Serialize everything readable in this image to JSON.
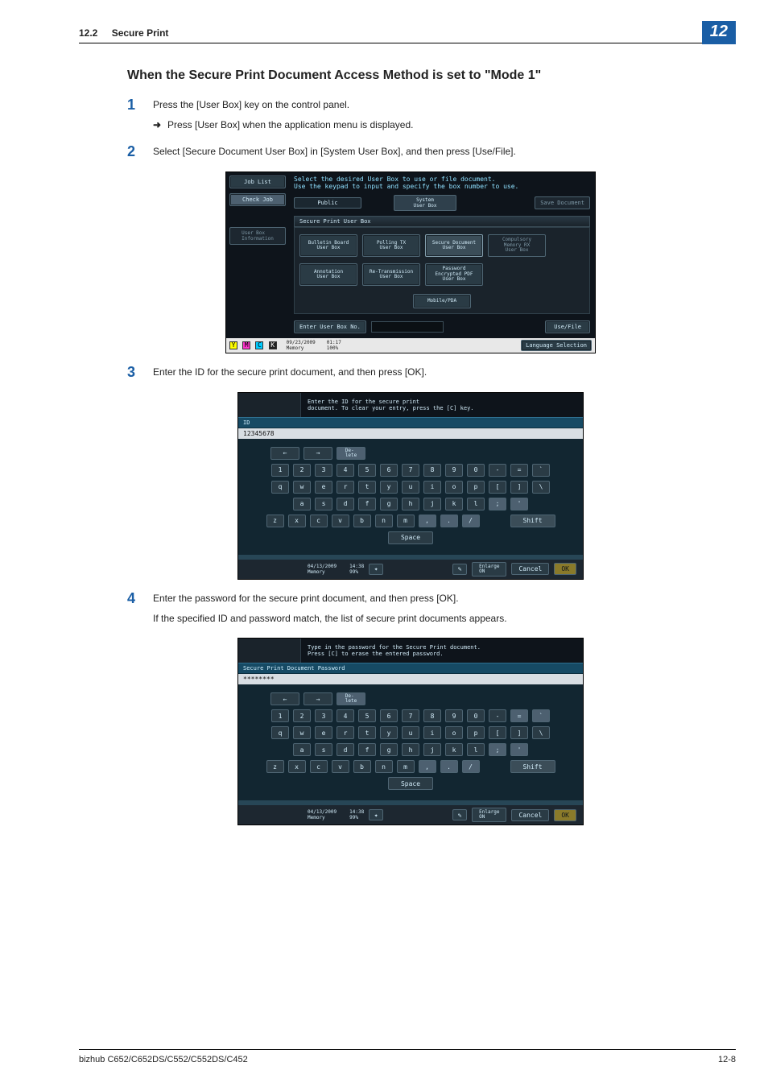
{
  "header": {
    "section_no": "12.2",
    "section_title": "Secure Print",
    "chapter_badge": "12"
  },
  "footer": {
    "model_line": "bizhub C652/C652DS/C552/C552DS/C452",
    "page_no": "12-8"
  },
  "body": {
    "subheading": "When the Secure Print Document Access Method is set to \"Mode 1\"",
    "step1": {
      "num": "1",
      "text": "Press the [User Box] key on the control panel.",
      "sub_arrow": "➜",
      "sub_text": "Press [User Box] when the application menu is displayed."
    },
    "step2": {
      "num": "2",
      "text": "Select [Secure Document User Box] in [System User Box], and then press [Use/File]."
    },
    "step3": {
      "num": "3",
      "text": "Enter the ID for the secure print document, and then press [OK]."
    },
    "step4": {
      "num": "4",
      "text_a": "Enter the password for the secure print document, and then press [OK].",
      "text_b": "If the specified ID and password match, the list of secure print documents appears."
    }
  },
  "shot1": {
    "instruction": "Select the desired User Box to use or file document.\nUse the keypad to input and specify the box number to use.",
    "side_job_list": "Job List",
    "side_check_job": "Check Job",
    "side_user_box_info": "User Box\nInformation",
    "tab_public": "Public",
    "tab_system": "System\nUser Box",
    "btn_save_doc": "Save Document",
    "section_label": "Secure Print User Box",
    "boxes": [
      "Bulletin Board\nUser Box",
      "Polling TX\nUser Box",
      "Secure Document\nUser Box",
      "Compulsory\nMemory RX\nUser Box",
      "Annotation\nUser Box",
      "Re-Transmission\nUser Box",
      "Password\nEncrypted PDF\nUser Box",
      "Mobile/PDA"
    ],
    "enter_box_no": "Enter User Box No.",
    "use_file": "Use/File",
    "date": "09/23/2009",
    "time": "01:17",
    "mem_label": "Memory",
    "mem_pct": "100%",
    "lang_sel": "Language Selection",
    "color_letters": [
      "Y",
      "M",
      "C",
      "K"
    ]
  },
  "shot2": {
    "instruction": "Enter the ID for the secure print\ndocument. To clear your entry, press the [C] key.",
    "field_label": "ID",
    "field_value": "12345678",
    "date": "04/13/2009",
    "time": "14:38",
    "mem_label": "Memory",
    "mem_pct": "99%",
    "enlarge": "Enlarge\nON",
    "cancel": "Cancel",
    "ok": "OK"
  },
  "shot3": {
    "instruction": "Type in the password for the Secure Print document.\nPress [C] to erase the entered password.",
    "field_label": "Secure Print Document Password",
    "field_value": "********",
    "date": "04/13/2009",
    "time": "14:38",
    "mem_label": "Memory",
    "mem_pct": "99%",
    "enlarge": "Enlarge\nON",
    "cancel": "Cancel",
    "ok": "OK"
  },
  "keypad": {
    "delete": "De-\nlete",
    "row1": [
      "1",
      "2",
      "3",
      "4",
      "5",
      "6",
      "7",
      "8",
      "9",
      "0",
      "-",
      "=",
      "`"
    ],
    "row2": [
      "q",
      "w",
      "e",
      "r",
      "t",
      "y",
      "u",
      "i",
      "o",
      "p",
      "[",
      "]",
      "\\"
    ],
    "row3": [
      "a",
      "s",
      "d",
      "f",
      "g",
      "h",
      "j",
      "k",
      "l",
      ";",
      "'"
    ],
    "row4": [
      "z",
      "x",
      "c",
      "v",
      "b",
      "n",
      "m",
      ",",
      ".",
      "/"
    ],
    "shift": "Shift",
    "space": "Space",
    "arrow_l": "←",
    "arrow_r": "→"
  }
}
